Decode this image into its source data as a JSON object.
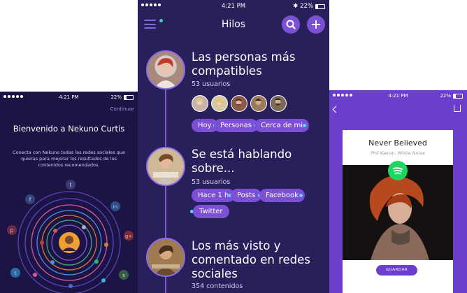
{
  "left": {
    "status": {
      "time": "4:21 PM",
      "battery": "22%"
    },
    "continue_label": "Continuar",
    "title": "Bienvenido a Nekuno Curtis",
    "description": "Conecta con Nekuno todas las redes sociales que quieras para mejorar los resultados de los contenidos recomendados."
  },
  "center": {
    "status": {
      "time": "4:21 PM",
      "battery": "22%"
    },
    "header_title": "Hilos",
    "threads": [
      {
        "title": "Las personas más compatibles",
        "subtitle": "53 usuarios",
        "tags": [
          "Hoy",
          "Personas",
          "Cerca de mi"
        ]
      },
      {
        "title": "Se está hablando sobre...",
        "subtitle": "53 usuarios",
        "tags": [
          "Hace 1 h",
          "Posts",
          "Facebook",
          "Twitter"
        ]
      },
      {
        "title": "Los más visto y comentado en redes sociales",
        "subtitle": "354 contenidos"
      }
    ]
  },
  "right": {
    "status": {
      "time": "4:21 PM",
      "battery": "22%"
    },
    "song_title": "Never Believed",
    "artist": "Phil Kieran, White Noise",
    "save_label": "GUARDAR"
  },
  "colors": {
    "left_bg": "#1c1444",
    "center_bg": "#27205a",
    "right_bg": "#6b3fcc",
    "accent": "#7b50d6",
    "spotify": "#1ed760"
  },
  "icons": [
    "menu-icon",
    "search-icon",
    "plus-icon",
    "back-icon",
    "share-icon",
    "spotify-icon",
    "tumblr-icon",
    "facebook-icon",
    "linkedin-icon",
    "pinterest-icon",
    "google-plus-icon",
    "twitter-icon",
    "steam-icon"
  ]
}
